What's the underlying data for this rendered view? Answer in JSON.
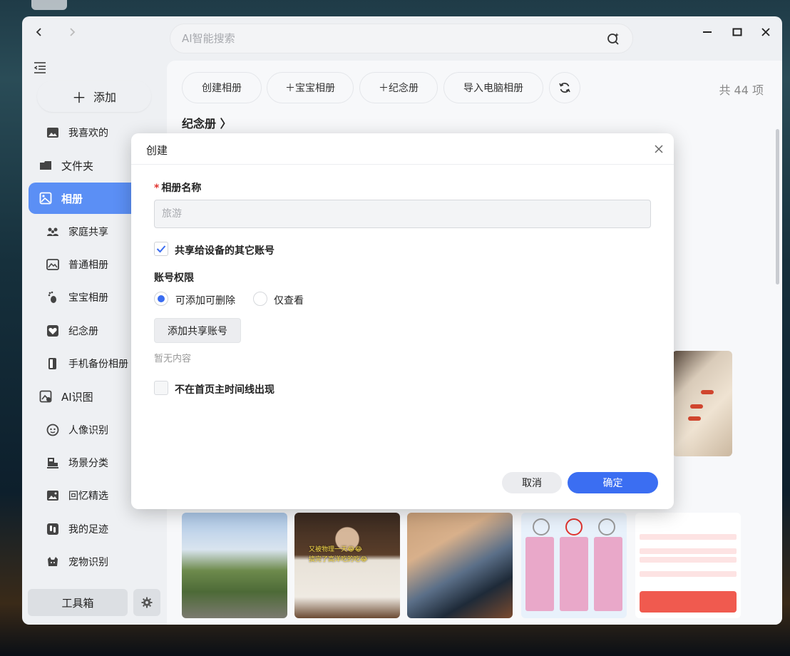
{
  "search": {
    "placeholder": "AI智能搜索"
  },
  "sidebar": {
    "add_label": "添加",
    "items": [
      {
        "label": "我喜欢的",
        "icon": "image-icon"
      },
      {
        "label": "文件夹",
        "icon": "folder-icon"
      },
      {
        "label": "相册",
        "icon": "album-icon",
        "active": true
      },
      {
        "label": "家庭共享",
        "icon": "family-icon"
      },
      {
        "label": "普通相册",
        "icon": "photo-icon"
      },
      {
        "label": "宝宝相册",
        "icon": "footprint-icon"
      },
      {
        "label": "纪念册",
        "icon": "heart-icon"
      },
      {
        "label": "手机备份相册",
        "icon": "phone-backup-icon"
      },
      {
        "label": "AI识图",
        "icon": "ai-image-icon"
      },
      {
        "label": "人像识别",
        "icon": "face-icon"
      },
      {
        "label": "场景分类",
        "icon": "scene-icon"
      },
      {
        "label": "回忆精选",
        "icon": "memory-icon"
      },
      {
        "label": "我的足迹",
        "icon": "footsteps-icon"
      },
      {
        "label": "宠物识别",
        "icon": "pet-icon"
      }
    ],
    "toolbox_label": "工具箱"
  },
  "toolbar": {
    "create_album": "创建相册",
    "baby_album": "＋宝宝相册",
    "memorial": "＋纪念册",
    "import_pc": "导入电脑相册",
    "total": "共 44 项"
  },
  "section": {
    "title": "纪念册 〉"
  },
  "dialog": {
    "title": "创建",
    "name_label": "相册名称",
    "required_mark": "*",
    "name_placeholder": "旅游",
    "share_label": "共享给设备的其它账号",
    "share_checked": true,
    "perm_label": "账号权限",
    "perm_option_full": "可添加可删除",
    "perm_option_view": "仅查看",
    "perm_selected": "可添加可删除",
    "add_account": "添加共享账号",
    "empty_note": "暂无内容",
    "timeline_label": "不在首页主时间线出现",
    "timeline_checked": false,
    "cancel": "取消",
    "confirm": "确定"
  },
  "thumbnail": {
    "caption": "又被物理一天😂😂\n搞完了高洋吃的吃😂"
  },
  "colors": {
    "accent": "#3b6ef2",
    "sidebar_active": "#5b8ff5",
    "required": "#e0332e"
  }
}
